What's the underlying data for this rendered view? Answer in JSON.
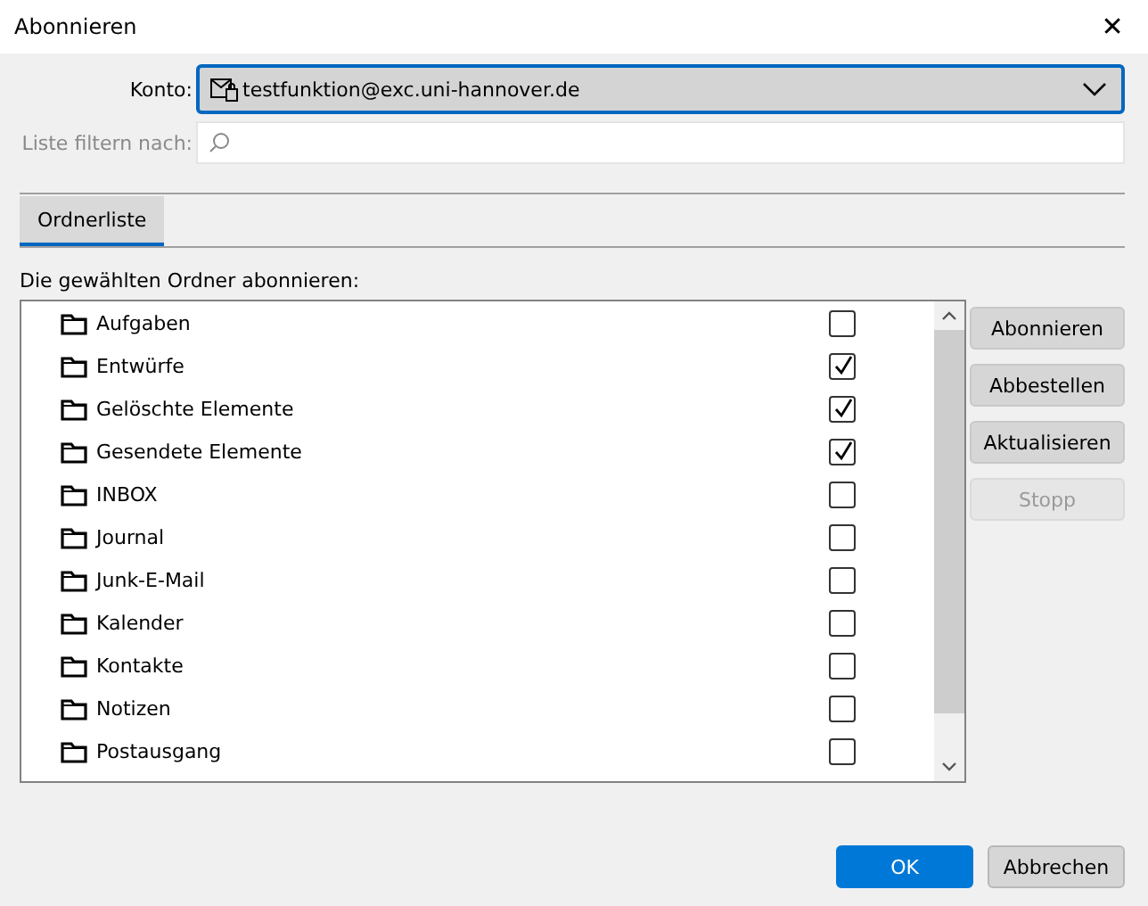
{
  "window": {
    "title": "Abonnieren",
    "close": "✕"
  },
  "account": {
    "label": "Konto:",
    "value": "testfunktion@exc.uni-hannover.de"
  },
  "filter": {
    "label": "Liste filtern nach:",
    "disabled": true
  },
  "tabs": [
    {
      "label": "Ordnerliste",
      "selected": true
    }
  ],
  "list_label": "Die gewählten Ordner abonnieren:",
  "folders": [
    {
      "name": "Aufgaben",
      "checked": false
    },
    {
      "name": "Entwürfe",
      "checked": true
    },
    {
      "name": "Gelöschte Elemente",
      "checked": true
    },
    {
      "name": "Gesendete Elemente",
      "checked": true
    },
    {
      "name": "INBOX",
      "checked": false
    },
    {
      "name": "Journal",
      "checked": false
    },
    {
      "name": "Junk-E-Mail",
      "checked": false
    },
    {
      "name": "Kalender",
      "checked": false
    },
    {
      "name": "Kontakte",
      "checked": false
    },
    {
      "name": "Notizen",
      "checked": false
    },
    {
      "name": "Postausgang",
      "checked": false
    }
  ],
  "side_buttons": [
    {
      "label": "Abonnieren",
      "disabled": false
    },
    {
      "label": "Abbestellen",
      "disabled": false
    },
    {
      "label": "Aktualisieren",
      "disabled": false
    },
    {
      "label": "Stopp",
      "disabled": true
    }
  ],
  "footer_buttons": [
    {
      "label": "OK",
      "kind": "primary"
    },
    {
      "label": "Abbrechen",
      "kind": "secondary"
    }
  ]
}
